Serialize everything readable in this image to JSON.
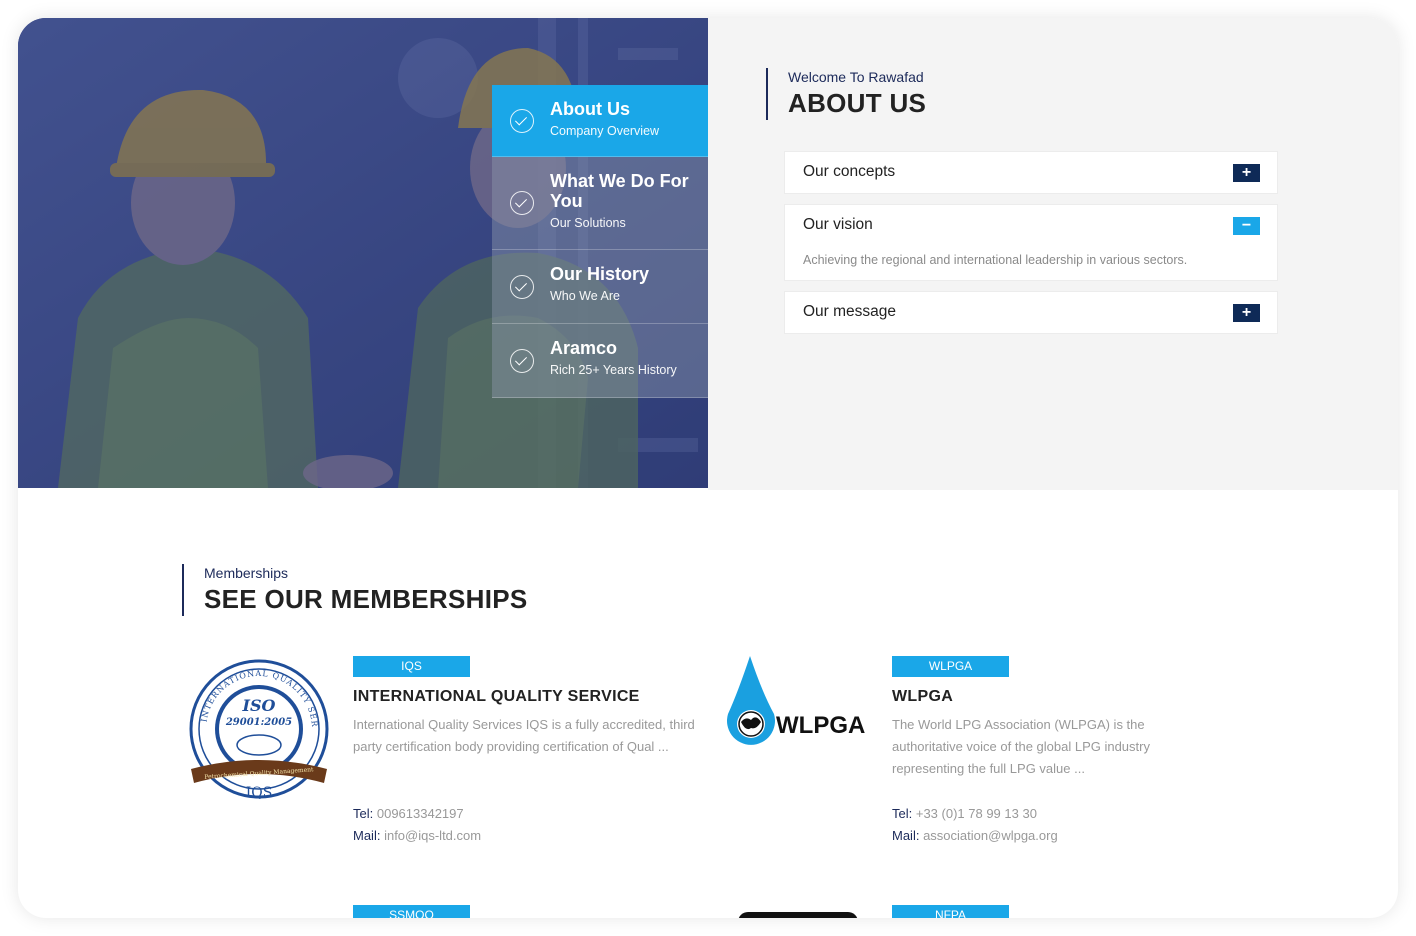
{
  "tabs": [
    {
      "title": "About Us",
      "subtitle": "Company Overview",
      "active": true
    },
    {
      "title": "What We Do For You",
      "subtitle": "Our Solutions",
      "active": false
    },
    {
      "title": "Our History",
      "subtitle": "Who We Are",
      "active": false
    },
    {
      "title": "Aramco",
      "subtitle": "Rich 25+ Years History",
      "active": false
    }
  ],
  "about": {
    "eyebrow": "Welcome To Rawafad",
    "heading": "ABOUT US",
    "accordion": [
      {
        "label": "Our concepts",
        "expanded": false,
        "icon": "plus-icon",
        "toggle": "+"
      },
      {
        "label": "Our vision",
        "expanded": true,
        "icon": "minus-icon",
        "toggle": "−",
        "body": "Achieving the regional and international leadership in various sectors."
      },
      {
        "label": "Our message",
        "expanded": false,
        "icon": "plus-icon",
        "toggle": "+"
      }
    ]
  },
  "memberships": {
    "eyebrow": "Memberships",
    "heading": "SEE OUR MEMBERSHIPS",
    "items": [
      {
        "badge": "IQS",
        "name": "INTERNATIONAL QUALITY SERVICE",
        "desc": "International Quality Services IQS is a fully accredited, third party certification body providing certification of Qual ...",
        "tel_label": "Tel:",
        "tel": "009613342197",
        "mail_label": "Mail:",
        "mail": "info@iqs-ltd.com",
        "logo": {
          "top": "INTERNATIONAL QUALITY SERVICES",
          "iso": "ISO",
          "std": "29001:2005",
          "ribbon": "Petrochemical Quality Management",
          "bottom": "IQS"
        }
      },
      {
        "badge": "WLPGA",
        "name": "WLPGA",
        "desc": "The World LPG Association (WLPGA) is the authoritative voice of the global LPG industry representing the full LPG value ...",
        "tel_label": "Tel:",
        "tel": "+33 (0)1 78 99 13 30",
        "mail_label": "Mail:",
        "mail": "association@wlpga.org",
        "logo": {
          "text": "WLPGA"
        }
      }
    ],
    "next_badges": [
      "SSMOO",
      "NFPA"
    ]
  },
  "colors": {
    "accent": "#1aa7e8",
    "navy": "#0e2a57",
    "hero_overlay": "#34427e",
    "panel_bg": "#f4f4f4"
  }
}
